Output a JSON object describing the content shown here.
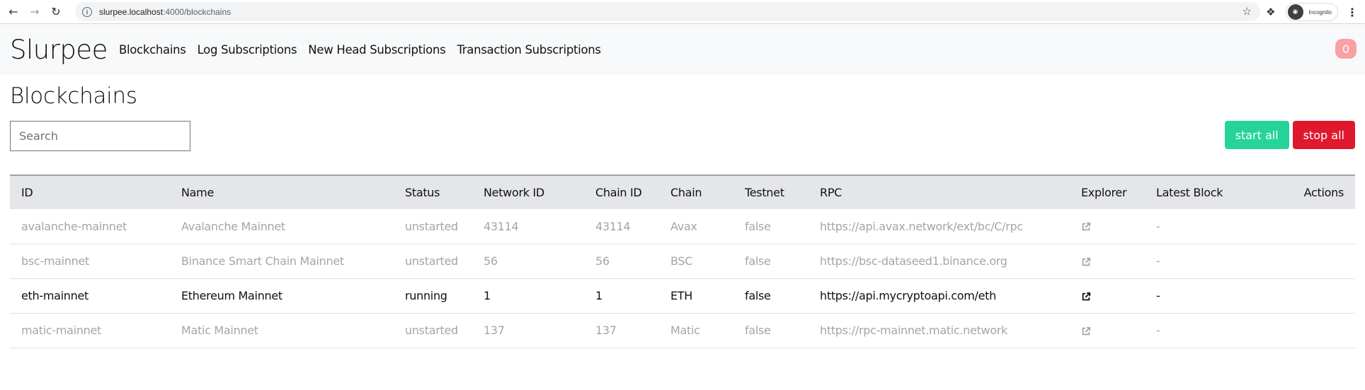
{
  "browser": {
    "url_host": "slurpee.localhost",
    "url_path": ":4000/blockchains",
    "incognito_label": "Incognito"
  },
  "navbar": {
    "brand": "Slurpee",
    "links": [
      "Blockchains",
      "Log Subscriptions",
      "New Head Subscriptions",
      "Transaction Subscriptions"
    ],
    "notification_count": "0",
    "badge_color": "#f8a0a4"
  },
  "page": {
    "title": "Blockchains",
    "search_placeholder": "Search",
    "search_value": "",
    "start_all_label": "start all",
    "stop_all_label": "stop all",
    "start_color": "#26d39a",
    "stop_color": "#e0182d"
  },
  "table": {
    "headers": [
      "ID",
      "Name",
      "Status",
      "Network ID",
      "Chain ID",
      "Chain",
      "Testnet",
      "RPC",
      "Explorer",
      "Latest Block",
      "Actions"
    ],
    "rows": [
      {
        "id": "avalanche-mainnet",
        "name": "Avalanche Mainnet",
        "status": "unstarted",
        "network_id": "43114",
        "chain_id": "43114",
        "chain": "Avax",
        "testnet": "false",
        "rpc": "https://api.avax.network/ext/bc/C/rpc",
        "explorer_icon": "external-link-icon",
        "latest_block": "-",
        "actions": ""
      },
      {
        "id": "bsc-mainnet",
        "name": "Binance Smart Chain Mainnet",
        "status": "unstarted",
        "network_id": "56",
        "chain_id": "56",
        "chain": "BSC",
        "testnet": "false",
        "rpc": "https://bsc-dataseed1.binance.org",
        "explorer_icon": "external-link-icon",
        "latest_block": "-",
        "actions": ""
      },
      {
        "id": "eth-mainnet",
        "name": "Ethereum Mainnet",
        "status": "running",
        "network_id": "1",
        "chain_id": "1",
        "chain": "ETH",
        "testnet": "false",
        "rpc": "https://api.mycryptoapi.com/eth",
        "explorer_icon": "external-link-icon",
        "latest_block": "-",
        "actions": ""
      },
      {
        "id": "matic-mainnet",
        "name": "Matic Mainnet",
        "status": "unstarted",
        "network_id": "137",
        "chain_id": "137",
        "chain": "Matic",
        "testnet": "false",
        "rpc": "https://rpc-mainnet.matic.network",
        "explorer_icon": "external-link-icon",
        "latest_block": "-",
        "actions": ""
      }
    ]
  }
}
